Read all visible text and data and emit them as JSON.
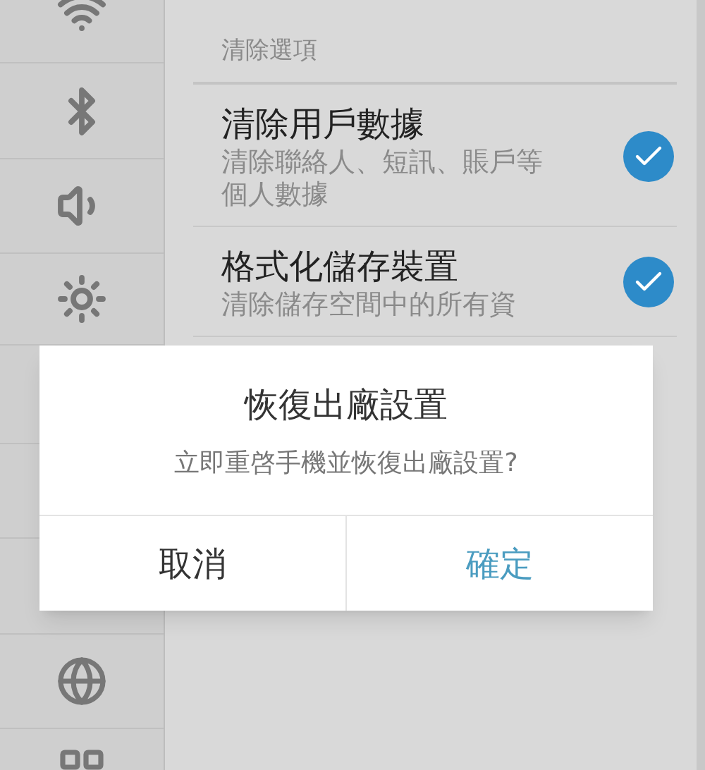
{
  "panel": {
    "section_title": "清除選項",
    "options": [
      {
        "title": "清除用戶數據",
        "description": "清除聯絡人、短訊、賬戶等個人數據",
        "checked": true
      },
      {
        "title": "格式化儲存裝置",
        "description": "清除儲存空間中的所有資",
        "checked": true
      }
    ]
  },
  "dialog": {
    "title": "恢復出廠設置",
    "message": "立即重啓手機並恢復出廠設置?",
    "buttons": [
      {
        "label": "取消",
        "kind": "cancel"
      },
      {
        "label": "確定",
        "kind": "confirm"
      }
    ]
  }
}
